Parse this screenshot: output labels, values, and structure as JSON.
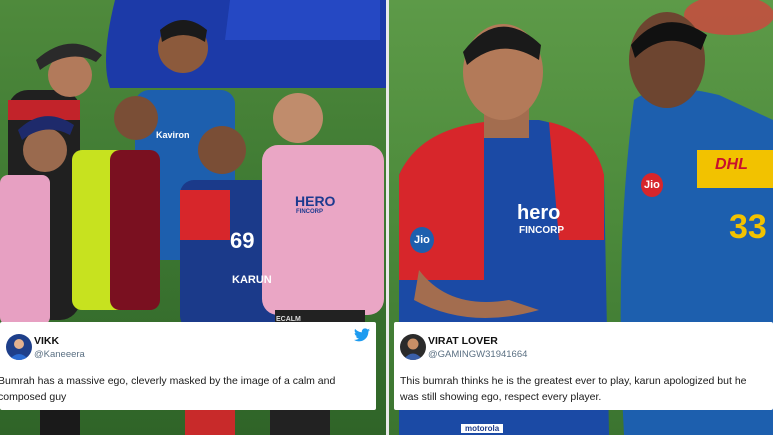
{
  "colors": {
    "mi_blue": "#1d5fae",
    "dc_red": "#d7262b",
    "dc_navy": "#1b3a8a",
    "umpire_pink": "#eaa6c5",
    "twitter_blue": "#1d9bf0",
    "handle_gray": "#5b7083"
  },
  "left_photo": {
    "jersey_number": "69",
    "jersey_name": "KARUN",
    "pink_shirt_sponsor": "HERO",
    "pink_shirt_sponsor_sub": "FINCORP",
    "mi_shirt_sponsor": "Kaviron",
    "dugout_sign": "ECALM"
  },
  "right_photo": {
    "jersey_sponsor_1": "Jio",
    "jersey_sponsor_2": "hero",
    "jersey_sponsor_2_sub": "FINCORP",
    "jersey_sponsor_3": "DHL",
    "jersey_sponsor_4": "Jio",
    "jersey_number": "33",
    "bottom_sponsor": "motorola"
  },
  "tweets": [
    {
      "name": "VIKK",
      "handle": "@Kaneeera",
      "avatar_icon": "profile-avatar",
      "text": "Bumrah has a massive ego, cleverly masked by the image of a calm and composed guy"
    },
    {
      "name": "VIRAT LOVER",
      "handle": "@GAMINGW31941664",
      "avatar_icon": "profile-avatar",
      "text": "This bumrah thinks he is the greatest ever to play, karun apologized but he was still showing ego, respect every player."
    }
  ]
}
